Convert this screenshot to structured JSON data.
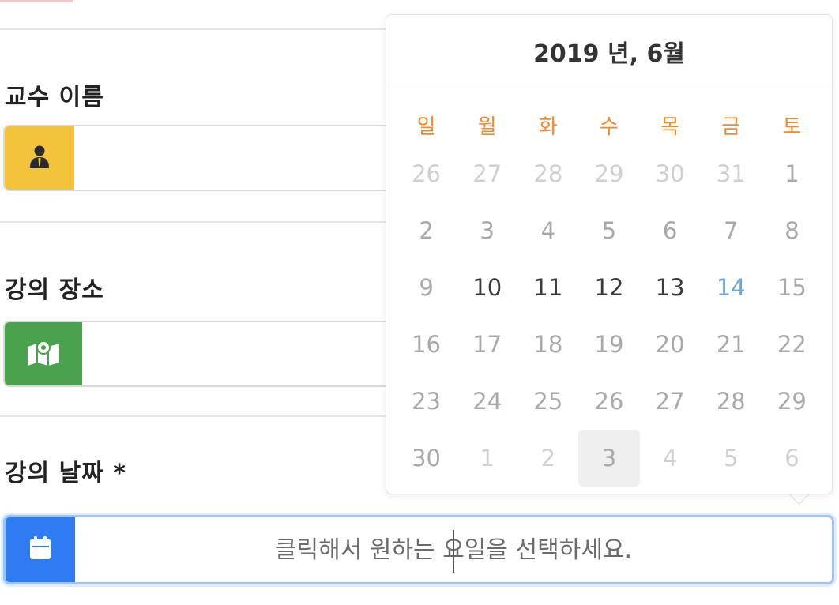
{
  "form": {
    "professor_label": "교수 이름",
    "location_label": "강의 장소",
    "date_label": "강의 날짜 *",
    "date_placeholder": "클릭해서 원하는 요일을 선택하세요."
  },
  "calendar": {
    "header": "2019 년, 6월",
    "weekdays": [
      "일",
      "월",
      "화",
      "수",
      "목",
      "금",
      "토"
    ],
    "days": [
      {
        "label": "26",
        "state": "other"
      },
      {
        "label": "27",
        "state": "other"
      },
      {
        "label": "28",
        "state": "other"
      },
      {
        "label": "29",
        "state": "other"
      },
      {
        "label": "30",
        "state": "other"
      },
      {
        "label": "31",
        "state": "other"
      },
      {
        "label": "1",
        "state": "normal"
      },
      {
        "label": "2",
        "state": "normal"
      },
      {
        "label": "3",
        "state": "normal"
      },
      {
        "label": "4",
        "state": "normal"
      },
      {
        "label": "5",
        "state": "normal"
      },
      {
        "label": "6",
        "state": "normal"
      },
      {
        "label": "7",
        "state": "normal"
      },
      {
        "label": "8",
        "state": "normal"
      },
      {
        "label": "9",
        "state": "normal"
      },
      {
        "label": "10",
        "state": "bold"
      },
      {
        "label": "11",
        "state": "bold"
      },
      {
        "label": "12",
        "state": "bold"
      },
      {
        "label": "13",
        "state": "bold"
      },
      {
        "label": "14",
        "state": "today"
      },
      {
        "label": "15",
        "state": "normal"
      },
      {
        "label": "16",
        "state": "normal"
      },
      {
        "label": "17",
        "state": "normal"
      },
      {
        "label": "18",
        "state": "normal"
      },
      {
        "label": "19",
        "state": "normal"
      },
      {
        "label": "20",
        "state": "normal"
      },
      {
        "label": "21",
        "state": "normal"
      },
      {
        "label": "22",
        "state": "normal"
      },
      {
        "label": "23",
        "state": "normal"
      },
      {
        "label": "24",
        "state": "normal"
      },
      {
        "label": "25",
        "state": "normal"
      },
      {
        "label": "26",
        "state": "normal"
      },
      {
        "label": "27",
        "state": "normal"
      },
      {
        "label": "28",
        "state": "normal"
      },
      {
        "label": "29",
        "state": "normal"
      },
      {
        "label": "30",
        "state": "normal"
      },
      {
        "label": "1",
        "state": "other"
      },
      {
        "label": "2",
        "state": "other"
      },
      {
        "label": "3",
        "state": "hover"
      },
      {
        "label": "4",
        "state": "other"
      },
      {
        "label": "5",
        "state": "other"
      },
      {
        "label": "6",
        "state": "other"
      }
    ]
  },
  "colors": {
    "professor_addon": "#f3c43b",
    "location_addon": "#4ba24c",
    "date_addon": "#2f7cf2",
    "weekday_text": "#f28a2c",
    "today_text": "#6ba6d6"
  },
  "icons": {
    "professor": "user-tie-icon",
    "location": "map-marker-icon",
    "date": "calendar-icon"
  }
}
